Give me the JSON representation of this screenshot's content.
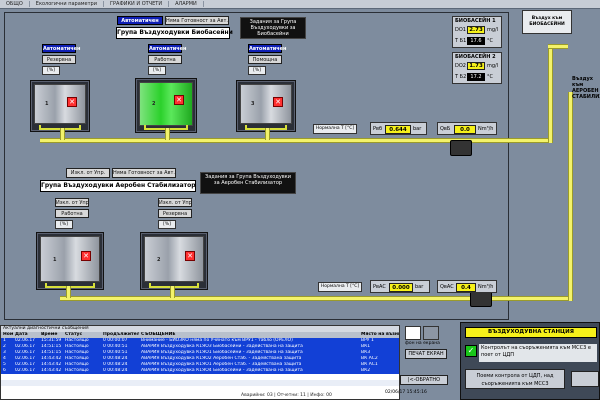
{
  "menu": [
    "ОБЩО",
    "Екологични параметри",
    "ГРАФИКИ И ОТЧЕТИ",
    "АЛАРМИ"
  ],
  "bio": {
    "mode_badge": "Автоматичен",
    "ready_btn": "Няма Готовност за Авт.Режим",
    "title": "Група Въздуходувки Биобасейни",
    "task_title": "Задания за Група Въздуходувки за Биобасейни",
    "units": [
      {
        "mode": "Автоматичен",
        "state": "Резервна",
        "pct": "[%]",
        "num": "1",
        "running": false
      },
      {
        "mode": "Автоматичен",
        "state": "Работна",
        "pct": "[%]",
        "num": "2",
        "running": true
      },
      {
        "mode": "Автоматичен",
        "state": "Помощна",
        "pct": "[%]",
        "num": "3",
        "running": false
      }
    ],
    "temp_label": "Нормална Т [°C]",
    "pressure_label": "Рвб",
    "pressure_value": "0.644",
    "pressure_unit": "bar",
    "flow_label": "QвБ",
    "flow_value": "0.0",
    "flow_unit": "Nm³/h"
  },
  "stab": {
    "mode_badge": "Изкл. от Упр.",
    "ready_btn": "Няма Готовност за Авт.Режим",
    "title": "Група Въздуходувки Аеробен Стабилизатор",
    "task_title": "Задания за Група Въздуходувки за Аеробен Стабилизатор",
    "units": [
      {
        "mode": "Изкл. от Упр.",
        "state": "Работна",
        "pct": "[%]",
        "num": "1"
      },
      {
        "mode": "Изкл. от Упр.",
        "state": "Резервна",
        "pct": "[%]",
        "num": "2"
      }
    ],
    "temp_label": "Нормална Т [°C]",
    "pressure_label": "РвАС",
    "pressure_value": "0.000",
    "pressure_unit": "bar",
    "flow_label": "QвАС",
    "flow_value": "0.4",
    "flow_unit": "Nm³/h"
  },
  "basin1": {
    "title": "БИОБАСЕЙН 1",
    "do_label": "DO1",
    "do_value": "2.73",
    "do_unit": "mg/l",
    "t_label": "T Б1",
    "t_value": "17.6",
    "t_unit": "°C"
  },
  "basin2": {
    "title": "БИОБАСЕЙН 2",
    "do_label": "DO2",
    "do_value": "1.73",
    "do_unit": "mg/l",
    "t_label": "T Б2",
    "t_value": "17.2",
    "t_unit": "°C"
  },
  "air_to_bio": "Въздух към БИОБАСЕЙНИ",
  "air_to_aero": "Въздух към АЕРОБЕН СТАБИЛИЗАТОР",
  "alarms": {
    "title": "Актуални диагностични съобщения",
    "headers": [
      "Ном.",
      "Дата",
      "Време",
      "Статус",
      "Продължителност",
      "СЪОБЩЕНИЕ",
      "Място на възникване"
    ],
    "rows": [
      [
        "1",
        "02.06.17",
        "15:31:59",
        "Настоящо",
        "0 00:00:07",
        "Внимание - БИОЗКО няма по Учйнато към ВРУ1 - табло (ОРЕЛО)",
        "ВРУ 1"
      ],
      [
        "2",
        "02.06.17",
        "14:51:15",
        "Настоящо",
        "0 00:40:51",
        "АВАРИЯ Въздуходувка К1ЯОЗ Биобасейни - Задействана на защита",
        "ВК1"
      ],
      [
        "3",
        "02.06.17",
        "14:51:15",
        "Настоящо",
        "0 00:40:51",
        "АВАРИЯ Въздуходувка К1ЯО1 Биобасейни - Задействана на защита",
        "ВК3"
      ],
      [
        "4",
        "02.06.17",
        "14:43:42",
        "Настоящо",
        "0 00:48:24",
        "АВАРИЯ Въздуходувка К1ЯО2 Аеробен Стаб. - Задействана защита",
        "ВК АС2"
      ],
      [
        "5",
        "02.06.17",
        "14:43:42",
        "Настоящо",
        "0 00:48:24",
        "АВАРИЯ Въздуходувка К1ЯО1 Аеробен Стаб. - Задействана защита",
        "ВК АС1"
      ],
      [
        "6",
        "02.06.17",
        "14:43:42",
        "Настоящо",
        "0 00:48:24",
        "АВАРИЯ Въздуходувка К1ЯО4 Биобасейни - Задействана на защита",
        "ВК2"
      ]
    ],
    "footer": "Аварийни: 03 | Отчетни: 11 | Инфо: 00"
  },
  "buttons": {
    "screen_bg": "фон на екрана",
    "print": "ПЕЧАТ ЕКРАН",
    "back": "|<-ОБРАТНО"
  },
  "station": {
    "title": "ВЪЗДУХОДУВНА СТАНЦИЯ",
    "control_note": "Контролът на съоръженията към МСС3 е поет от ЦДП",
    "take_control": "Поеми контрола от ЦДП, над съоръженията към МСС3",
    "datetime": "02/06/17 15:45:16"
  }
}
